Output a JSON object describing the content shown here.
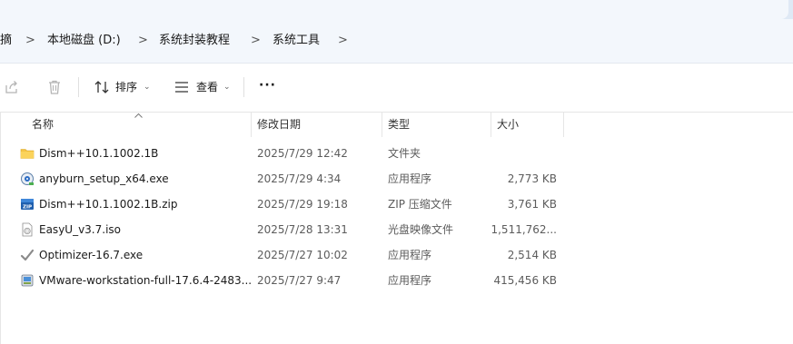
{
  "breadcrumb": {
    "items": [
      "摘",
      "本地磁盘 (D:)",
      "系统封装教程",
      "系统工具"
    ],
    "separator": ">"
  },
  "toolbar": {
    "share_icon": "share-icon",
    "delete_icon": "trash-icon",
    "sort_label": "排序",
    "view_label": "查看",
    "more_label": "···"
  },
  "columns": {
    "name": "名称",
    "date": "修改日期",
    "type": "类型",
    "size": "大小"
  },
  "files": [
    {
      "name": "Dism++10.1.1002.1B",
      "date": "2025/7/29 12:42",
      "type": "文件夹",
      "size": "",
      "icon": "folder-icon"
    },
    {
      "name": "anyburn_setup_x64.exe",
      "date": "2025/7/29 4:34",
      "type": "应用程序",
      "size": "2,773 KB",
      "icon": "installer-icon"
    },
    {
      "name": "Dism++10.1.1002.1B.zip",
      "date": "2025/7/29 19:18",
      "type": "ZIP 压缩文件",
      "size": "3,761 KB",
      "icon": "zip-icon"
    },
    {
      "name": "EasyU_v3.7.iso",
      "date": "2025/7/28 13:31",
      "type": "光盘映像文件",
      "size": "1,511,762...",
      "icon": "disc-image-icon"
    },
    {
      "name": "Optimizer-16.7.exe",
      "date": "2025/7/27 10:02",
      "type": "应用程序",
      "size": "2,514 KB",
      "icon": "checkmark-app-icon"
    },
    {
      "name": "VMware-workstation-full-17.6.4-2483...",
      "date": "2025/7/27 9:47",
      "type": "应用程序",
      "size": "415,456 KB",
      "icon": "vmware-installer-icon"
    }
  ],
  "colors": {
    "tabstrip": "#dfe9f5",
    "addressbar": "#f3f7fc",
    "folder": "#f5c445",
    "accent": "#2b6cc4"
  }
}
